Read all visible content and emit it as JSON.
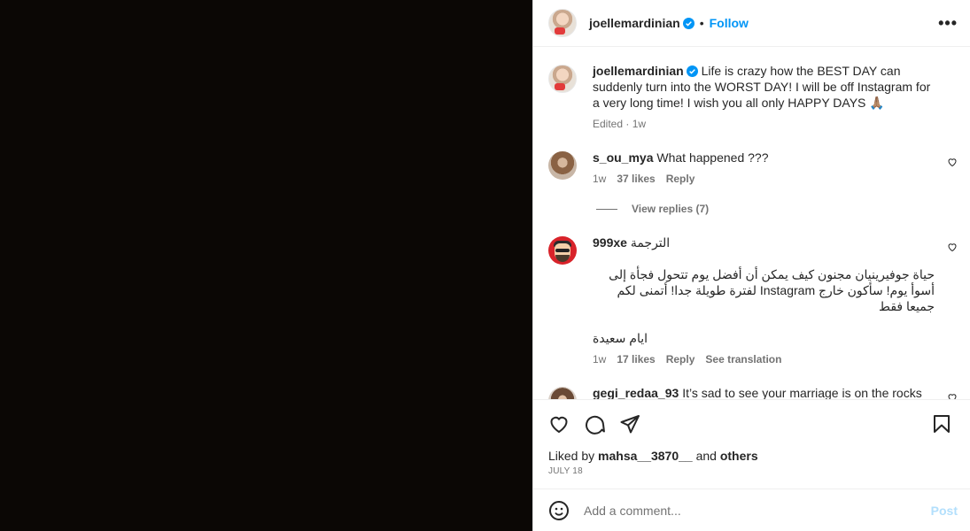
{
  "header": {
    "username": "joellemardinian",
    "follow_label": "Follow",
    "separator": "•",
    "more_label": "•••"
  },
  "caption": {
    "username": "joellemardinian",
    "text": "Life is crazy how the BEST DAY can suddenly turn into the WORST DAY! I will be off Instagram for a very long time! I wish you all only HAPPY DAYS 🙏🏽",
    "edited": "Edited",
    "sep": "·",
    "time": "1w"
  },
  "comments": [
    {
      "username": "s_ou_mya",
      "text": "What happened ???",
      "time": "1w",
      "likes": "37 likes",
      "reply": "Reply"
    },
    {
      "username": "999xe",
      "text_label": "الترجمة",
      "body1": "حياة جوفيرينيان مجنون كيف يمكن أن أفضل يوم تتحول فجأة إلى أسوأ يوم! سأكون خارج Instagram لفترة طويلة جدا! أتمنى لكم جميعا فقط",
      "body2": "ايام سعيدة",
      "time": "1w",
      "likes": "17 likes",
      "reply": "Reply",
      "translate": "See translation"
    },
    {
      "username": "gegi_redaa_93",
      "text": "It’s sad to see your marriage is on the rocks"
    }
  ],
  "view_replies": "View replies (7)",
  "likes": {
    "prefix": "Liked by",
    "user": "mahsa__3870__",
    "and": "and",
    "others": "others"
  },
  "date": "JULY 18",
  "add_comment": {
    "placeholder": "Add a comment...",
    "post_label": "Post"
  },
  "colors": {
    "accent": "#0095f6",
    "post_disabled": "#b2dffc",
    "muted": "#737373"
  }
}
